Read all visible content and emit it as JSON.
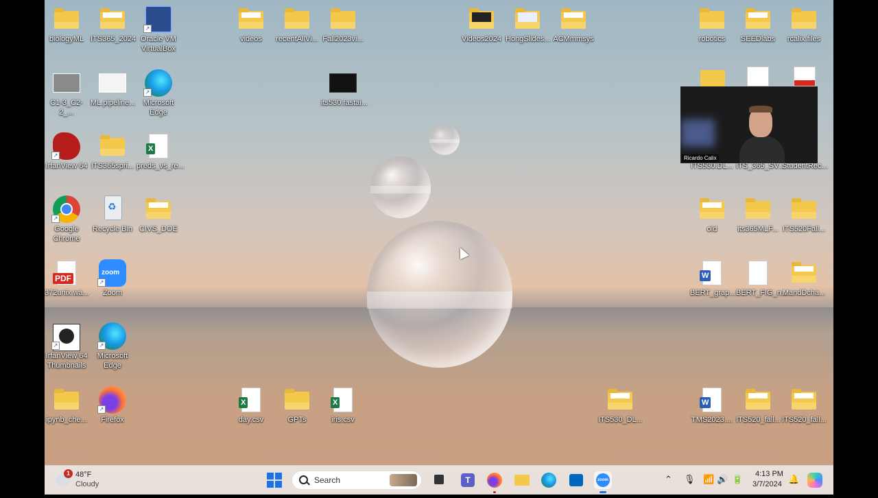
{
  "desktop": {
    "icons": [
      {
        "id": "biologyml",
        "label": "biologyML",
        "type": "folder"
      },
      {
        "id": "its365-2024",
        "label": "ITS365_2024",
        "type": "folder"
      },
      {
        "id": "virtualbox",
        "label": "Oracle VM VirtualBox",
        "type": "app",
        "icon": "virtualbox-icon"
      },
      {
        "id": "videos",
        "label": "videos",
        "type": "folder"
      },
      {
        "id": "recentallvi",
        "label": "recentAllVi...",
        "type": "folder"
      },
      {
        "id": "fall2023vi",
        "label": "Fall2023vi...",
        "type": "folder"
      },
      {
        "id": "videos2024",
        "label": "Videos2024",
        "type": "folder"
      },
      {
        "id": "hongslides",
        "label": "HongSlides...",
        "type": "folder"
      },
      {
        "id": "acmmmsys",
        "label": "ACMmmsys",
        "type": "folder"
      },
      {
        "id": "robotics",
        "label": "robotics",
        "type": "folder"
      },
      {
        "id": "seedlabs",
        "label": "SEEDlabs",
        "type": "folder"
      },
      {
        "id": "rcalixfiles",
        "label": "rcalix.files",
        "type": "folder"
      },
      {
        "id": "c1-3",
        "label": "C1-3_C2-2_...",
        "type": "image"
      },
      {
        "id": "mlpipeline",
        "label": "ML.pipeline...",
        "type": "image"
      },
      {
        "id": "edge1",
        "label": "Microsoft Edge",
        "type": "app",
        "icon": "edge-icon"
      },
      {
        "id": "its530fastai",
        "label": "its530.fastai...",
        "type": "video"
      },
      {
        "id": "irfanview64",
        "label": "IrfanView 64",
        "type": "app",
        "icon": "irfanview-icon"
      },
      {
        "id": "its365spri",
        "label": "ITS365spri...",
        "type": "folder"
      },
      {
        "id": "preds",
        "label": "preds_vs_re...",
        "type": "excel"
      },
      {
        "id": "its530dl",
        "label": "ITS530.DL...",
        "type": "folder"
      },
      {
        "id": "its365sv",
        "label": "ITS_365_SV...",
        "type": "file"
      },
      {
        "id": "studentrec",
        "label": "StudentRec...",
        "type": "pdf"
      },
      {
        "id": "chrome",
        "label": "Google Chrome",
        "type": "app",
        "icon": "chrome-icon"
      },
      {
        "id": "recyclebin",
        "label": "Recycle Bin",
        "type": "app",
        "icon": "recycle-bin-icon"
      },
      {
        "id": "civsdoe",
        "label": "CIVS_DOE",
        "type": "folder"
      },
      {
        "id": "old",
        "label": "old",
        "type": "folder"
      },
      {
        "id": "its365mlf",
        "label": "its365MLF...",
        "type": "folder"
      },
      {
        "id": "its520fall1",
        "label": "ITS520Fall...",
        "type": "folder"
      },
      {
        "id": "372unix",
        "label": "372unix.wa...",
        "type": "pdf"
      },
      {
        "id": "zoom",
        "label": "Zoom",
        "type": "app",
        "icon": "zoom-icon"
      },
      {
        "id": "bertgrap",
        "label": "BERT_grap...",
        "type": "word"
      },
      {
        "id": "bertfig",
        "label": "BERT_FIG_n...",
        "type": "file"
      },
      {
        "id": "mandcha",
        "label": "MandDcha...",
        "type": "folder"
      },
      {
        "id": "irfanthumbs",
        "label": "IrfanView 64 Thumbnails",
        "type": "app",
        "icon": "irfanview-thumbnails-icon"
      },
      {
        "id": "edge2",
        "label": "Microsoft Edge",
        "type": "app",
        "icon": "edge-icon"
      },
      {
        "id": "ipynbche",
        "label": "ipynb_che...",
        "type": "folder"
      },
      {
        "id": "firefox",
        "label": "Firefox",
        "type": "app",
        "icon": "firefox-icon"
      },
      {
        "id": "daycsv",
        "label": "day.csv",
        "type": "excel"
      },
      {
        "id": "gpts",
        "label": "GPTs",
        "type": "folder"
      },
      {
        "id": "iriscsv",
        "label": "iris.csv",
        "type": "excel"
      },
      {
        "id": "its530dl2",
        "label": "ITS530_DL...",
        "type": "folder"
      },
      {
        "id": "tms2023",
        "label": "TMS2023....",
        "type": "word"
      },
      {
        "id": "its520fall2",
        "label": "ITS520_fall...",
        "type": "folder"
      },
      {
        "id": "its520fall3",
        "label": "ITS520_fall...",
        "type": "folder"
      }
    ]
  },
  "webcam": {
    "name": "Ricardo Calix"
  },
  "taskbar": {
    "weather": {
      "temp": "48°F",
      "condition": "Cloudy",
      "badge": "1"
    },
    "search_label": "Search",
    "apps": [
      {
        "name": "task-view",
        "icon": "task-view-icon",
        "color": "#333333"
      },
      {
        "name": "teams",
        "icon": "teams-icon",
        "color": "#5b5fc7"
      },
      {
        "name": "firefox",
        "icon": "firefox-icon",
        "color": "#ff7139"
      },
      {
        "name": "file-explorer",
        "icon": "folder-icon",
        "color": "#f4c84b"
      },
      {
        "name": "edge",
        "icon": "edge-icon",
        "color": "#1a9be6"
      },
      {
        "name": "store",
        "icon": "store-icon",
        "color": "#0067c0"
      },
      {
        "name": "zoom",
        "icon": "zoom-icon",
        "color": "#2d8cff"
      }
    ],
    "clock": {
      "time": "4:13 PM",
      "date": "3/7/2024"
    }
  }
}
